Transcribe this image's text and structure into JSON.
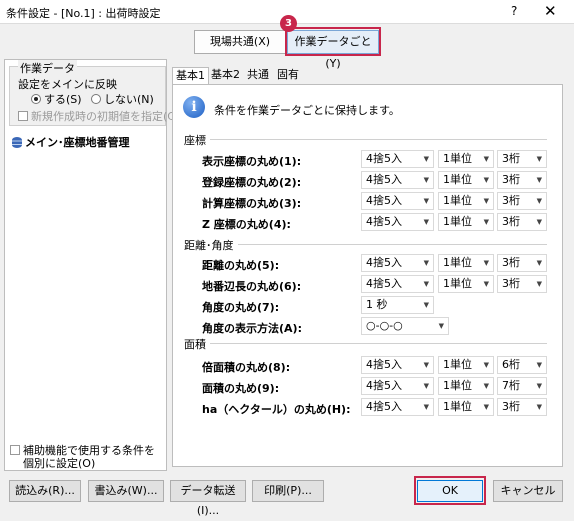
{
  "window": {
    "title": "条件設定 - [No.1] : 出荷時設定",
    "help_label": "?",
    "close_label": "✕"
  },
  "top_tabs": {
    "site_common": "現場共通(X)",
    "per_data": "作業データごと(Y)",
    "step_badge": "3"
  },
  "left": {
    "group_title": "作業データ",
    "reflect_label": "設定をメインに反映",
    "radio_yes": "する(S)",
    "radio_no": "しない(N)",
    "new_init_label": "新規作成時の初期値を指定(C)",
    "tree_item": "メイン･座標地番管理",
    "aux_line1": "補助機能で使用する条件を",
    "aux_line2": "個別に設定(O)"
  },
  "inner_tabs": [
    "基本1",
    "基本2",
    "共通",
    "固有"
  ],
  "info": {
    "icon_glyph": "i",
    "text": "条件を作業データごとに保持します。"
  },
  "sections": {
    "coords": "座標",
    "distance": "距離･角度",
    "area": "面積"
  },
  "rows": [
    {
      "label": "表示座標の丸め(1):",
      "v1": "4捨5入",
      "v2": "1単位",
      "v3": "3桁"
    },
    {
      "label": "登録座標の丸め(2):",
      "v1": "4捨5入",
      "v2": "1単位",
      "v3": "3桁"
    },
    {
      "label": "計算座標の丸め(3):",
      "v1": "4捨5入",
      "v2": "1単位",
      "v3": "3桁"
    },
    {
      "label": "Z 座標の丸め(4):",
      "v1": "4捨5入",
      "v2": "1単位",
      "v3": "3桁"
    },
    {
      "label": "距離の丸め(5):",
      "v1": "4捨5入",
      "v2": "1単位",
      "v3": "3桁"
    },
    {
      "label": "地番辺長の丸め(6):",
      "v1": "4捨5入",
      "v2": "1単位",
      "v3": "3桁"
    },
    {
      "label": "角度の丸め(7):",
      "v1": "1 秒"
    },
    {
      "label": "角度の表示方法(A):",
      "v1": "○-○-○"
    },
    {
      "label": "倍面積の丸め(8):",
      "v1": "4捨5入",
      "v2": "1単位",
      "v3": "6桁"
    },
    {
      "label": "面積の丸め(9):",
      "v1": "4捨5入",
      "v2": "1単位",
      "v3": "7桁"
    },
    {
      "label": "ha（ヘクタール）の丸め(H):",
      "v1": "4捨5入",
      "v2": "1単位",
      "v3": "3桁"
    }
  ],
  "buttons": {
    "read": "読込み(R)...",
    "write": "書込み(W)...",
    "transfer": "データ転送(I)...",
    "print": "印刷(P)...",
    "ok": "OK",
    "cancel": "キャンセル"
  },
  "icons": {
    "info": "info-icon",
    "database": "database-icon",
    "dropdown": "chevron-down-icon"
  },
  "colors": {
    "highlight": "#c8264b",
    "selected_tab": "#e5eef8",
    "info_icon": "#1d5fc4"
  }
}
